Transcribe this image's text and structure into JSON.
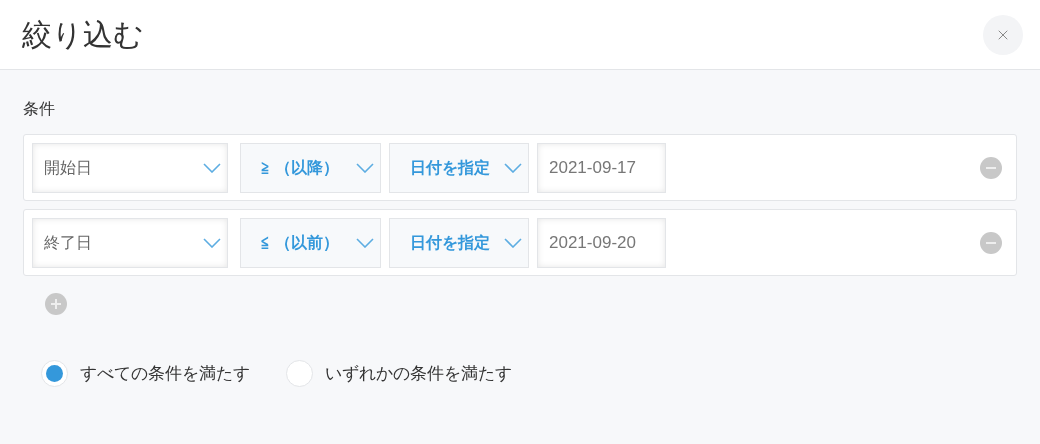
{
  "dialog": {
    "title": "絞り込む"
  },
  "section_label": "条件",
  "conditions": [
    {
      "field": "開始日",
      "operator": "≧ （以降）",
      "value_type": "日付を指定",
      "date": "2021-09-17"
    },
    {
      "field": "終了日",
      "operator": "≦ （以前）",
      "value_type": "日付を指定",
      "date": "2021-09-20"
    }
  ],
  "match_options": [
    {
      "label": "すべての条件を満たす",
      "selected": true
    },
    {
      "label": "いずれかの条件を満たす",
      "selected": false
    }
  ]
}
